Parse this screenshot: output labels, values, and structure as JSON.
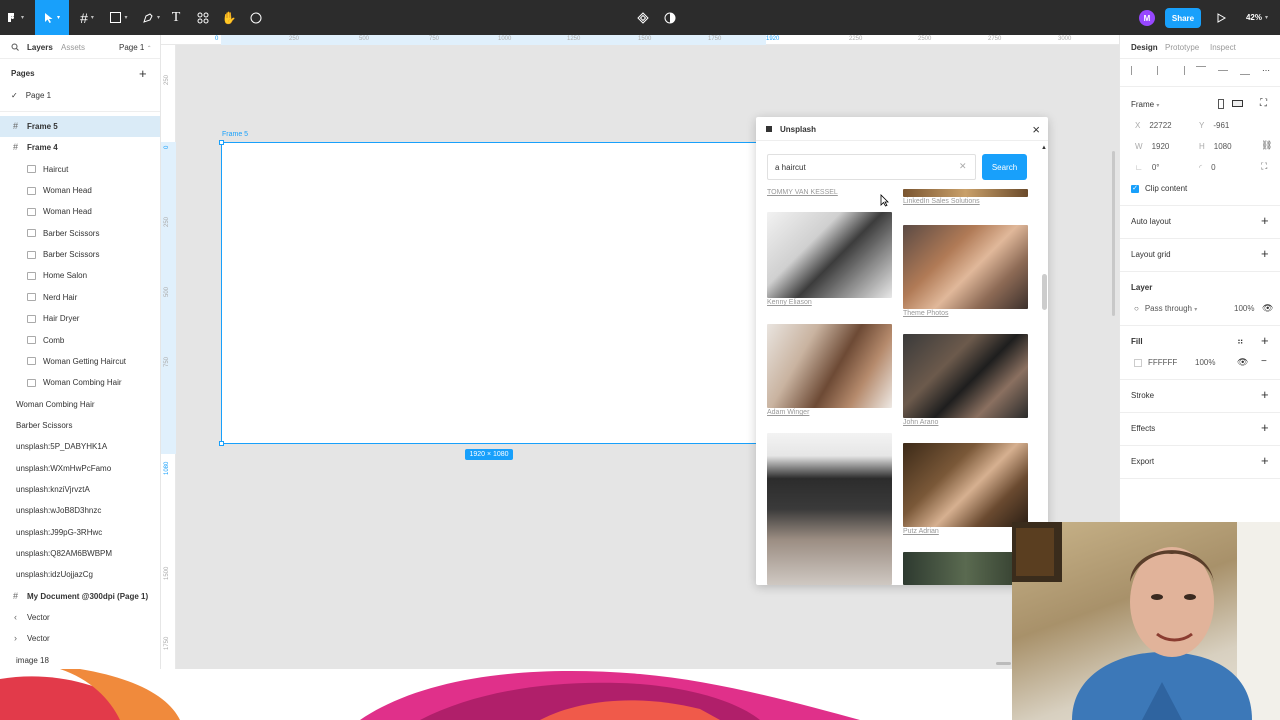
{
  "toolbar": {
    "share_label": "Share",
    "zoom": "42%",
    "avatar_initial": "M"
  },
  "left_panel": {
    "tabs": [
      "Layers",
      "Assets"
    ],
    "page_selector": "Page 1",
    "pages_heading": "Pages",
    "pages": [
      "Page 1"
    ],
    "layers": [
      {
        "label": "Frame 5",
        "kind": "frame",
        "indent": 0,
        "selected": true
      },
      {
        "label": "Frame 4",
        "kind": "frame",
        "indent": 0,
        "selected": false
      },
      {
        "label": "Haircut",
        "kind": "image",
        "indent": 1
      },
      {
        "label": "Woman Head",
        "kind": "image",
        "indent": 1
      },
      {
        "label": "Woman Head",
        "kind": "image",
        "indent": 1
      },
      {
        "label": "Barber Scissors",
        "kind": "image",
        "indent": 1
      },
      {
        "label": "Barber Scissors",
        "kind": "image",
        "indent": 1
      },
      {
        "label": "Home Salon",
        "kind": "image",
        "indent": 1
      },
      {
        "label": "Nerd Hair",
        "kind": "image",
        "indent": 1
      },
      {
        "label": "Hair Dryer",
        "kind": "image",
        "indent": 1
      },
      {
        "label": "Comb",
        "kind": "image",
        "indent": 1
      },
      {
        "label": "Woman Getting Haircut",
        "kind": "image",
        "indent": 1
      },
      {
        "label": "Woman Combing Hair",
        "kind": "image",
        "indent": 1
      },
      {
        "label": "Woman Combing Hair",
        "kind": "image",
        "indent": 0
      },
      {
        "label": "Barber Scissors",
        "kind": "image",
        "indent": 0
      },
      {
        "label": "unsplash:5P_DABYHK1A",
        "kind": "image",
        "indent": 0
      },
      {
        "label": "unsplash:WXmHwPcFamo",
        "kind": "image",
        "indent": 0
      },
      {
        "label": "unsplash:knziVjrvztA",
        "kind": "image",
        "indent": 0
      },
      {
        "label": "unsplash:wJoB8D3hnzc",
        "kind": "image",
        "indent": 0
      },
      {
        "label": "unsplash:J99pG-3RHwc",
        "kind": "image",
        "indent": 0
      },
      {
        "label": "unsplash:Q82AM6BWBPM",
        "kind": "image",
        "indent": 0
      },
      {
        "label": "unsplash:idzUojjazCg",
        "kind": "image",
        "indent": 0
      },
      {
        "label": "My Document @300dpi (Page 1)",
        "kind": "frame",
        "indent": 0,
        "bold": true
      },
      {
        "label": "Vector",
        "kind": "vector-left",
        "indent": 0
      },
      {
        "label": "Vector",
        "kind": "vector-right",
        "indent": 0
      },
      {
        "label": "image 18",
        "kind": "image",
        "indent": 0
      }
    ]
  },
  "canvas": {
    "ruler_top": [
      "0",
      "250",
      "500",
      "750",
      "1000",
      "1250",
      "1500",
      "1750",
      "1920",
      "2250",
      "2500",
      "2750",
      "3000"
    ],
    "ruler_left": [
      "250",
      "0",
      "250",
      "500",
      "750",
      "1080",
      "1500",
      "1750"
    ],
    "frame_label": "Frame 5",
    "size_badge": "1920 × 1080"
  },
  "plugin": {
    "title": "Unsplash",
    "search_value": "a haircut",
    "search_placeholder": "Search",
    "search_button": "Search",
    "photos": [
      {
        "credit": "TOMMY VAN KESSEL",
        "col": 0
      },
      {
        "credit": "LinkedIn Sales Solutions",
        "col": 1
      },
      {
        "credit": "Kenny Eliason",
        "col": 0
      },
      {
        "credit": "Theme Photos",
        "col": 1
      },
      {
        "credit": "Adam Winger",
        "col": 0
      },
      {
        "credit": "John Arano",
        "col": 1
      },
      {
        "credit": "Putz Adrian",
        "col": 1
      }
    ]
  },
  "right_panel": {
    "tabs": [
      "Design",
      "Prototype",
      "Inspect"
    ],
    "frame_label": "Frame",
    "x_label": "X",
    "x_value": "22722",
    "y_label": "Y",
    "y_value": "-961",
    "w_label": "W",
    "w_value": "1920",
    "h_label": "H",
    "h_value": "1080",
    "rotation": "0°",
    "radius": "0",
    "clip_content": "Clip content",
    "auto_layout": "Auto layout",
    "layout_grid": "Layout grid",
    "layer_heading": "Layer",
    "blend_mode": "Pass through",
    "layer_opacity": "100%",
    "fill_heading": "Fill",
    "fill_hex": "FFFFFF",
    "fill_opacity": "100%",
    "stroke_heading": "Stroke",
    "effects_heading": "Effects",
    "export_heading": "Export"
  },
  "colors": {
    "accent": "#18a0fb",
    "toolbar_bg": "#2c2c2c"
  }
}
